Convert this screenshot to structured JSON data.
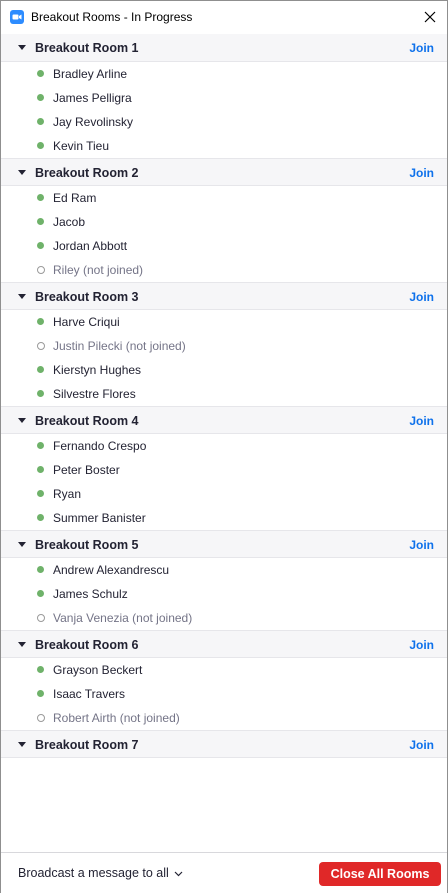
{
  "window": {
    "title": "Breakout Rooms - In Progress",
    "app_icon": "zoom-camera-icon",
    "close_icon": "close-icon"
  },
  "colors": {
    "accent_blue": "#0e71eb",
    "joined_green": "#6fb26a",
    "danger_red": "#e02828",
    "header_bg": "#f6f6f8"
  },
  "rooms": [
    {
      "name": "Breakout Room 1",
      "join_label": "Join",
      "members": [
        {
          "name": "Bradley Arline",
          "joined": true
        },
        {
          "name": "James Pelligra",
          "joined": true
        },
        {
          "name": "Jay Revolinsky",
          "joined": true
        },
        {
          "name": "Kevin Tieu",
          "joined": true
        }
      ]
    },
    {
      "name": "Breakout Room 2",
      "join_label": "Join",
      "members": [
        {
          "name": "Ed Ram",
          "joined": true
        },
        {
          "name": "Jacob",
          "joined": true
        },
        {
          "name": "Jordan Abbott",
          "joined": true
        },
        {
          "name": "Riley (not joined)",
          "joined": false
        }
      ]
    },
    {
      "name": "Breakout Room 3",
      "join_label": "Join",
      "members": [
        {
          "name": "Harve Criqui",
          "joined": true
        },
        {
          "name": "Justin Pilecki (not joined)",
          "joined": false
        },
        {
          "name": "Kierstyn Hughes",
          "joined": true
        },
        {
          "name": "Silvestre Flores",
          "joined": true
        }
      ]
    },
    {
      "name": "Breakout Room 4",
      "join_label": "Join",
      "members": [
        {
          "name": "Fernando Crespo",
          "joined": true
        },
        {
          "name": "Peter Boster",
          "joined": true
        },
        {
          "name": "Ryan",
          "joined": true
        },
        {
          "name": "Summer Banister",
          "joined": true
        }
      ]
    },
    {
      "name": "Breakout Room 5",
      "join_label": "Join",
      "members": [
        {
          "name": "Andrew Alexandrescu",
          "joined": true
        },
        {
          "name": "James Schulz",
          "joined": true
        },
        {
          "name": "Vanja Venezia (not joined)",
          "joined": false
        }
      ]
    },
    {
      "name": "Breakout Room 6",
      "join_label": "Join",
      "members": [
        {
          "name": "Grayson Beckert",
          "joined": true
        },
        {
          "name": "Isaac Travers",
          "joined": true
        },
        {
          "name": "Robert Airth (not joined)",
          "joined": false
        }
      ]
    },
    {
      "name": "Breakout Room 7",
      "join_label": "Join",
      "members": []
    }
  ],
  "footer": {
    "broadcast_label": "Broadcast a message to all",
    "broadcast_icon": "chevron-down-icon",
    "close_all_label": "Close All Rooms"
  }
}
